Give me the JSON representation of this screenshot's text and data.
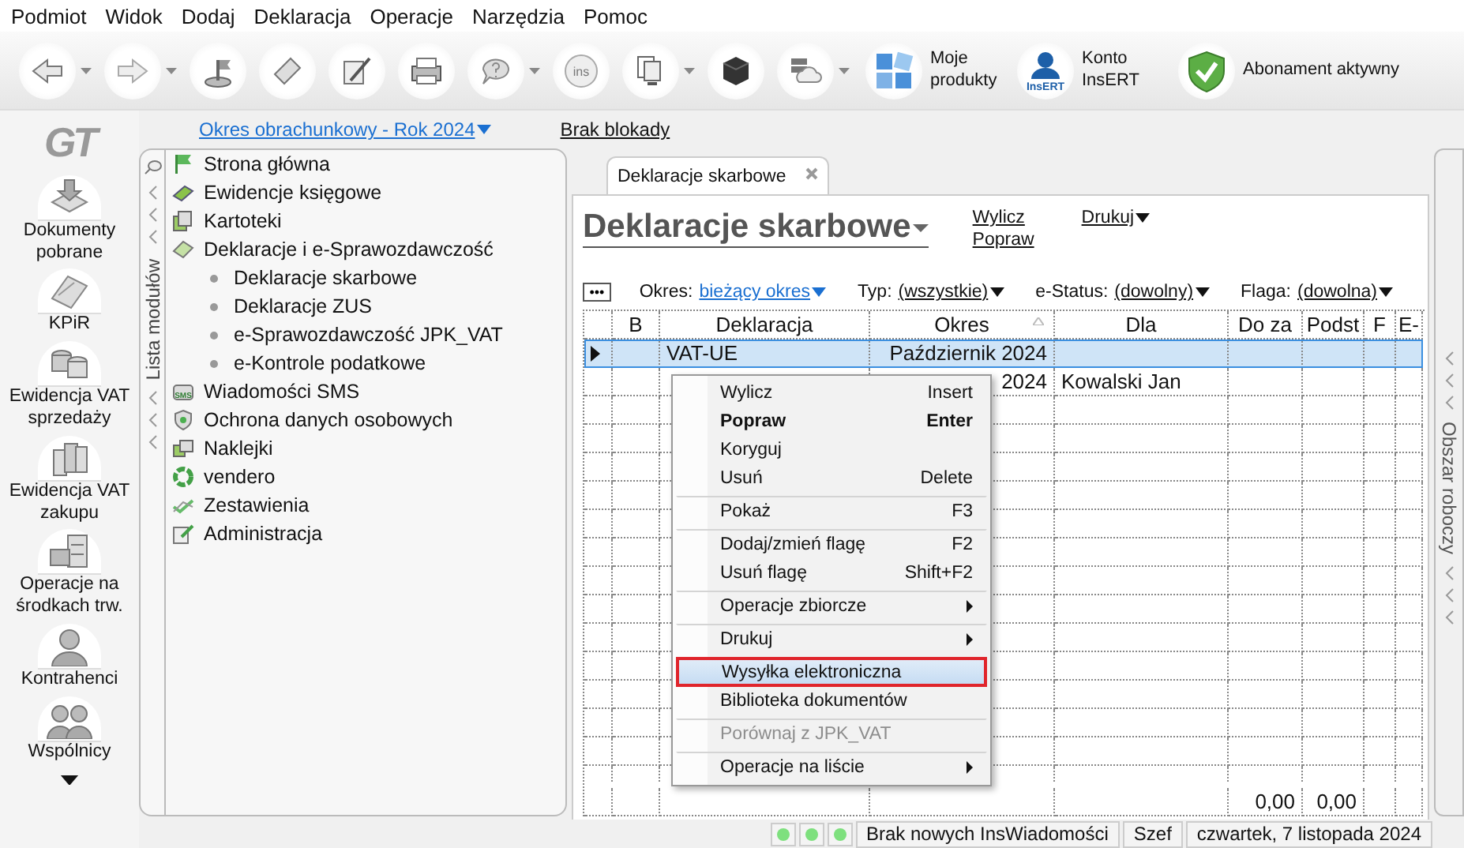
{
  "menu_bar": [
    "Podmiot",
    "Widok",
    "Dodaj",
    "Deklaracja",
    "Operacje",
    "Narzędzia",
    "Pomoc"
  ],
  "toolbar": {
    "icon_buttons": [
      {
        "has_menu": true
      },
      {
        "has_menu": true
      },
      {
        "has_menu": false
      },
      {
        "has_menu": false
      },
      {
        "has_menu": false
      },
      {
        "has_menu": false
      },
      {
        "has_menu": true
      },
      {
        "has_menu": false,
        "icon_text": "ins"
      },
      {
        "has_menu": true
      },
      {
        "has_menu": false
      },
      {
        "has_menu": true
      }
    ],
    "text_buttons": [
      {
        "label": "Moje produkty"
      },
      {
        "label": "Konto InsERT",
        "icon_text": "InsERT"
      },
      {
        "label": "Abonament aktywny"
      }
    ]
  },
  "sidebar": {
    "logo": "GT",
    "items": [
      {
        "label": "Dokumenty pobrane"
      },
      {
        "label": "KPiR"
      },
      {
        "label": "Ewidencja VAT sprzedaży"
      },
      {
        "label": "Ewidencja VAT zakupu"
      },
      {
        "label": "Operacje na środkach trw."
      },
      {
        "label": "Kontrahenci"
      },
      {
        "label": "Wspólnicy"
      }
    ]
  },
  "top_links": {
    "period": "Okres obrachunkowy - Rok 2024",
    "lock": "Brak blokady"
  },
  "modules": {
    "label": "Lista modułów",
    "items": [
      {
        "label": "Strona główna"
      },
      {
        "label": "Ewidencje księgowe"
      },
      {
        "label": "Kartoteki"
      },
      {
        "label": "Deklaracje i e-Sprawozdawczość",
        "children": [
          {
            "label": "Deklaracje skarbowe"
          },
          {
            "label": "Deklaracje ZUS"
          },
          {
            "label": "e-Sprawozdawczość JPK_VAT"
          },
          {
            "label": "e-Kontrole podatkowe"
          }
        ]
      },
      {
        "label": "Wiadomości SMS",
        "icon_text": "SMS"
      },
      {
        "label": "Ochrona danych osobowych"
      },
      {
        "label": "Naklejki"
      },
      {
        "label": "vendero"
      },
      {
        "label": "Zestawienia"
      },
      {
        "label": "Administracja"
      }
    ]
  },
  "workspace": {
    "tab": "Deklaracje skarbowe",
    "title": "Deklaracje skarbowe",
    "actions": [
      "Wylicz",
      "Popraw"
    ],
    "print": "Drukuj",
    "more_button": "•••",
    "filters": [
      {
        "label": "Okres:",
        "value": "bieżący okres",
        "kind": "link"
      },
      {
        "label": "Typ:",
        "value": "(wszystkie)",
        "kind": "plain"
      },
      {
        "label": "e-Status:",
        "value": "(dowolny)",
        "kind": "plain"
      },
      {
        "label": "Flaga:",
        "value": "(dowolna)",
        "kind": "plain"
      }
    ],
    "table": {
      "columns": [
        {
          "label": "B",
          "sorted": false
        },
        {
          "label": "Deklaracja",
          "sorted": false
        },
        {
          "label": "Okres",
          "sorted": true
        },
        {
          "label": "Dla",
          "sorted": false
        },
        {
          "label": "Do za",
          "sorted": false
        },
        {
          "label": "Podst",
          "sorted": false
        },
        {
          "label": "F",
          "sorted": false
        },
        {
          "label": "E-",
          "sorted": false
        }
      ],
      "rows": [
        {
          "selected": true,
          "cells": {
            "column_2": "VAT-UE",
            "column_3": "Październik 2024"
          }
        },
        {
          "selected": false,
          "cells": {
            "column_3": "2024",
            "column_4": "Kowalski Jan"
          }
        }
      ],
      "totals": {
        "column_5": "0,00",
        "column_6": "0,00"
      }
    }
  },
  "right_panel": {
    "label": "Obszar roboczy"
  },
  "context_menu": [
    {
      "label": "Wylicz",
      "shortcut": "Insert",
      "bold": false,
      "disabled": false,
      "submenu": false,
      "selected": false,
      "separator_before": false
    },
    {
      "label": "Popraw",
      "shortcut": "Enter",
      "bold": true,
      "disabled": false,
      "submenu": false,
      "selected": false,
      "separator_before": false
    },
    {
      "label": "Koryguj",
      "bold": false,
      "disabled": false,
      "submenu": false,
      "selected": false,
      "separator_before": false
    },
    {
      "label": "Usuń",
      "shortcut": "Delete",
      "bold": false,
      "disabled": false,
      "submenu": false,
      "selected": false,
      "separator_before": false
    },
    {
      "label": "Pokaż",
      "shortcut": "F3",
      "bold": false,
      "disabled": false,
      "submenu": false,
      "selected": false,
      "separator_before": true
    },
    {
      "label": "Dodaj/zmień flagę",
      "shortcut": "F2",
      "bold": false,
      "disabled": false,
      "submenu": false,
      "selected": false,
      "separator_before": true
    },
    {
      "label": "Usuń flagę",
      "shortcut": "Shift+F2",
      "bold": false,
      "disabled": false,
      "submenu": false,
      "selected": false,
      "separator_before": false
    },
    {
      "label": "Operacje zbiorcze",
      "bold": false,
      "disabled": false,
      "submenu": true,
      "selected": false,
      "separator_before": true
    },
    {
      "label": "Drukuj",
      "bold": false,
      "disabled": false,
      "submenu": true,
      "selected": false,
      "separator_before": true
    },
    {
      "label": "Wysyłka elektroniczna",
      "bold": false,
      "disabled": false,
      "submenu": false,
      "selected": true,
      "separator_before": true
    },
    {
      "label": "Biblioteka dokumentów",
      "bold": false,
      "disabled": false,
      "submenu": false,
      "selected": false,
      "separator_before": false
    },
    {
      "label": "Porównaj z JPK_VAT",
      "bold": false,
      "disabled": true,
      "submenu": false,
      "selected": false,
      "separator_before": true
    },
    {
      "label": "Operacje na liście",
      "bold": false,
      "disabled": false,
      "submenu": true,
      "selected": false,
      "separator_before": true
    }
  ],
  "status_bar": {
    "messages": "Brak nowych InsWiadomości",
    "user": "Szef",
    "date": "czwartek, 7 listopada 2024"
  }
}
